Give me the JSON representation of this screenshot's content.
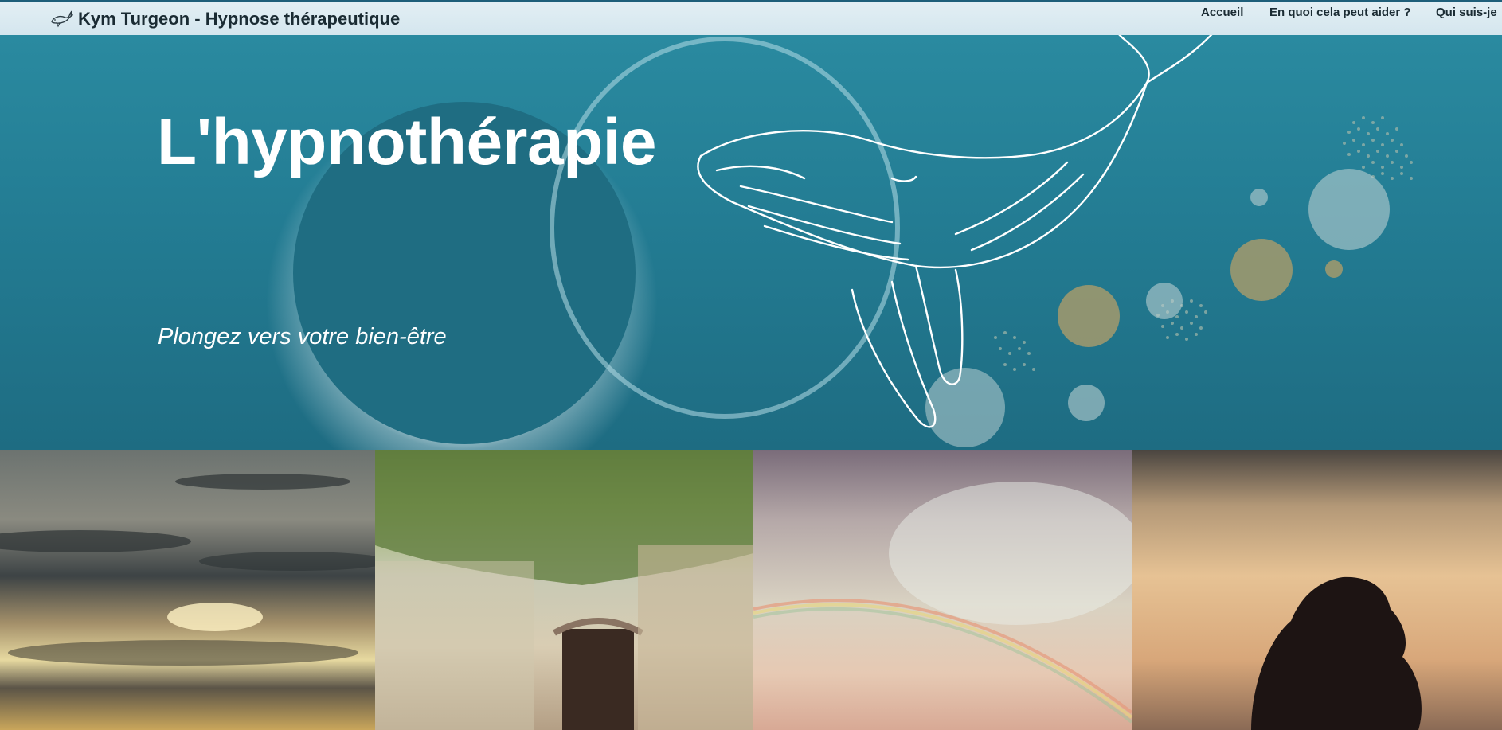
{
  "site": {
    "brand_title": "Kym Turgeon - Hypnose thérapeutique",
    "logo_icon": "whale-logo-icon"
  },
  "nav": {
    "items": [
      {
        "label": "Accueil"
      },
      {
        "label": "En quoi cela peut aider ?"
      },
      {
        "label": "Qui suis-je"
      }
    ]
  },
  "hero": {
    "title": "L'hypnothérapie",
    "subtitle": "Plongez vers votre bien-être"
  },
  "gallery": {
    "images": [
      {
        "name": "sunset-clouds-image"
      },
      {
        "name": "stone-alley-image"
      },
      {
        "name": "rainbow-sky-image"
      },
      {
        "name": "sad-woman-silhouette-image"
      }
    ]
  },
  "colors": {
    "hero_bg": "#237c93",
    "navbar_bg": "#dcebf1",
    "text_dark": "#1a2b33",
    "accent_olive": "#a39a6c"
  }
}
